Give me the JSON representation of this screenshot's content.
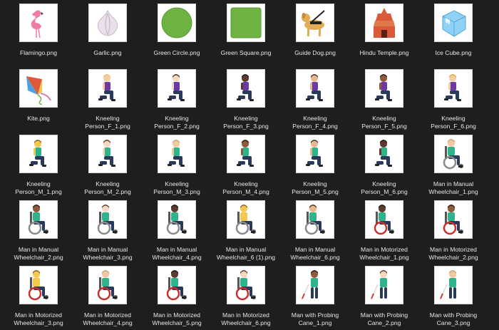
{
  "files": [
    {
      "name": "Flamingo.png",
      "icon": "flamingo-icon",
      "kind": "flamingo",
      "color": "#f07ca0"
    },
    {
      "name": "Garlic.png",
      "icon": "garlic-icon",
      "kind": "garlic",
      "color": "#e9e0ea"
    },
    {
      "name": "Green Circle.png",
      "icon": "green-circle-icon",
      "kind": "circle",
      "color": "#6fb443"
    },
    {
      "name": "Green Square.png",
      "icon": "green-square-icon",
      "kind": "square",
      "color": "#6fb443"
    },
    {
      "name": "Guide Dog.png",
      "icon": "guide-dog-icon",
      "kind": "dog",
      "color": "#e3ad55"
    },
    {
      "name": "Hindu Temple.png",
      "icon": "hindu-temple-icon",
      "kind": "temple",
      "color": "#d9593a"
    },
    {
      "name": "Ice Cube.png",
      "icon": "ice-cube-icon",
      "kind": "ice",
      "color": "#8fd2f5"
    },
    {
      "name": "Kite.png",
      "icon": "kite-icon",
      "kind": "kite",
      "color": "#e4583a"
    },
    {
      "name": "Kneeling Person_F_1.png",
      "icon": "kneeling-woman-icon",
      "kind": "kneel",
      "skin": "#f4cda7",
      "hair": "#e9c36a",
      "shirt": "#6d3aa3"
    },
    {
      "name": "Kneeling Person_F_2.png",
      "icon": "kneeling-woman-icon",
      "kind": "kneel",
      "skin": "#f6d7c1",
      "hair": "#4b2c20",
      "shirt": "#6d3aa3"
    },
    {
      "name": "Kneeling Person_F_3.png",
      "icon": "kneeling-woman-icon",
      "kind": "kneel",
      "skin": "#5c3b2e",
      "hair": "#1f1512",
      "shirt": "#6d3aa3"
    },
    {
      "name": "Kneeling Person_F_4.png",
      "icon": "kneeling-woman-icon",
      "kind": "kneel",
      "skin": "#e7b78e",
      "hair": "#4b2c20",
      "shirt": "#6d3aa3"
    },
    {
      "name": "Kneeling Person_F_5.png",
      "icon": "kneeling-woman-icon",
      "kind": "kneel",
      "skin": "#8d5a3b",
      "hair": "#2a1a12",
      "shirt": "#6d3aa3"
    },
    {
      "name": "Kneeling Person_F_6.png",
      "icon": "kneeling-woman-icon",
      "kind": "kneel",
      "skin": "#f4cda7",
      "hair": "#e0a93c",
      "shirt": "#6d3aa3"
    },
    {
      "name": "Kneeling Person_M_1.png",
      "icon": "kneeling-man-icon",
      "kind": "kneel",
      "skin": "#f2c94c",
      "hair": "#8b5a2b",
      "shirt": "#2fb38a"
    },
    {
      "name": "Kneeling\nPerson_M_2.png",
      "icon": "kneeling-man-icon",
      "kind": "kneel",
      "skin": "#f6d7c1",
      "hair": "#5a3a22",
      "shirt": "#2fb38a"
    },
    {
      "name": "Kneeling\nPerson_M_3.png",
      "icon": "kneeling-man-icon",
      "kind": "kneel",
      "skin": "#f0c9a0",
      "hair": "#c9a56a",
      "shirt": "#2fb38a"
    },
    {
      "name": "Kneeling\nPerson_M_4.png",
      "icon": "kneeling-man-icon",
      "kind": "kneel",
      "skin": "#8d5a3b",
      "hair": "#2a1a12",
      "shirt": "#2fb38a"
    },
    {
      "name": "Kneeling\nPerson_M_5.png",
      "icon": "kneeling-man-icon",
      "kind": "kneel",
      "skin": "#e7b78e",
      "hair": "#4b2c20",
      "shirt": "#2fb38a"
    },
    {
      "name": "Kneeling\nPerson_M_6.png",
      "icon": "kneeling-man-icon",
      "kind": "kneel",
      "skin": "#5c3b2e",
      "hair": "#1f1512",
      "shirt": "#2fb38a"
    },
    {
      "name": "Man in Manual\nWheelchair_1.png",
      "icon": "man-manual-wheelchair-icon",
      "kind": "wheel",
      "skin": "#f0c9a0",
      "hair": "#c9a56a",
      "shirt": "#2fb38a"
    },
    {
      "name": "Man in Manual\nWheelchair_2.png",
      "icon": "man-manual-wheelchair-icon",
      "kind": "wheel",
      "skin": "#8d5a3b",
      "hair": "#2a1a12",
      "shirt": "#2fb38a"
    },
    {
      "name": "Man in Manual\nWheelchair_3.png",
      "icon": "man-manual-wheelchair-icon",
      "kind": "wheel",
      "skin": "#f6d7c1",
      "hair": "#5a3a22",
      "shirt": "#2fb38a"
    },
    {
      "name": "Man in Manual\nWheelchair_4.png",
      "icon": "man-manual-wheelchair-icon",
      "kind": "wheel",
      "skin": "#5c3b2e",
      "hair": "#1f1512",
      "shirt": "#2fb38a"
    },
    {
      "name": "Man in Manual\nWheelchair_6 (1).png",
      "icon": "man-manual-wheelchair-icon",
      "kind": "wheel",
      "skin": "#f2c94c",
      "hair": "#8b5a2b",
      "shirt": "#f2c94c"
    },
    {
      "name": "Man in Manual\nWheelchair_6.png",
      "icon": "man-manual-wheelchair-icon",
      "kind": "wheel",
      "skin": "#e7b78e",
      "hair": "#4b2c20",
      "shirt": "#2fb38a"
    },
    {
      "name": "Man in Motorized\nWheelchair_1.png",
      "icon": "man-motorized-wheelchair-icon",
      "kind": "motor",
      "skin": "#5c3b2e",
      "hair": "#1f1512",
      "shirt": "#2fb38a"
    },
    {
      "name": "Man in Motorized\nWheelchair_2.png",
      "icon": "man-motorized-wheelchair-icon",
      "kind": "motor",
      "skin": "#8d5a3b",
      "hair": "#2a1a12",
      "shirt": "#2fb38a"
    },
    {
      "name": "Man in Motorized\nWheelchair_3.png",
      "icon": "man-motorized-wheelchair-icon",
      "kind": "motor",
      "skin": "#f2c94c",
      "hair": "#8b5a2b",
      "shirt": "#f2c94c"
    },
    {
      "name": "Man in Motorized\nWheelchair_4.png",
      "icon": "man-motorized-wheelchair-icon",
      "kind": "motor",
      "skin": "#f0c9a0",
      "hair": "#c9a56a",
      "shirt": "#2fb38a"
    },
    {
      "name": "Man in Motorized\nWheelchair_5.png",
      "icon": "man-motorized-wheelchair-icon",
      "kind": "motor",
      "skin": "#5c3b2e",
      "hair": "#1f1512",
      "shirt": "#2fb38a"
    },
    {
      "name": "Man in Motorized\nWheelchair_6.png",
      "icon": "man-motorized-wheelchair-icon",
      "kind": "motor",
      "skin": "#f6d7c1",
      "hair": "#5a3a22",
      "shirt": "#2fb38a"
    },
    {
      "name": "Man with Probing\nCane_1.png",
      "icon": "man-probing-cane-icon",
      "kind": "cane",
      "skin": "#8d5a3b",
      "hair": "#2a1a12",
      "shirt": "#2fb38a"
    },
    {
      "name": "Man with Probing\nCane_2.png",
      "icon": "man-probing-cane-icon",
      "kind": "cane",
      "skin": "#f6d7c1",
      "hair": "#5a3a22",
      "shirt": "#2fb38a"
    },
    {
      "name": "Man with Probing\nCane_3.png",
      "icon": "man-probing-cane-icon",
      "kind": "cane",
      "skin": "#f0c9a0",
      "hair": "#c9a56a",
      "shirt": "#2fb38a"
    }
  ]
}
